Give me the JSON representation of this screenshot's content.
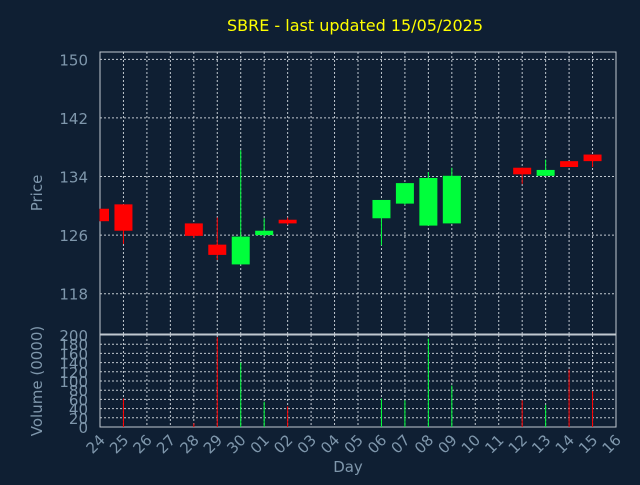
{
  "chart_data": [
    {
      "type": "candlestick",
      "title": "SBRE - last updated 15/05/2025",
      "ylabel": "Price",
      "xlabel": "Day",
      "ylim": [
        112.5,
        151
      ],
      "yticks": [
        118,
        126,
        134,
        142,
        150
      ],
      "grid": true,
      "categories": [
        "24",
        "25",
        "26",
        "27",
        "28",
        "29",
        "30",
        "01",
        "02",
        "03",
        "04",
        "05",
        "06",
        "07",
        "08",
        "09",
        "10",
        "11",
        "12",
        "13",
        "14",
        "15",
        "16"
      ],
      "candles": [
        {
          "day": "24",
          "open": 129.6,
          "high": 129.6,
          "low": 127.9,
          "close": 127.9
        },
        {
          "day": "25",
          "open": 130.2,
          "high": 130.2,
          "low": 124.8,
          "close": 126.6
        },
        {
          "day": "28",
          "open": 127.6,
          "high": 127.6,
          "low": 125.6,
          "close": 125.9
        },
        {
          "day": "29",
          "open": 124.7,
          "high": 128.4,
          "low": 122.6,
          "close": 123.3
        },
        {
          "day": "30",
          "open": 122.0,
          "high": 137.6,
          "low": 122.0,
          "close": 125.8
        },
        {
          "day": "01",
          "open": 126.0,
          "high": 128.3,
          "low": 125.8,
          "close": 126.6
        },
        {
          "day": "02",
          "open": 128.1,
          "high": 128.4,
          "low": 127.4,
          "close": 127.6
        },
        {
          "day": "06",
          "open": 128.3,
          "high": 130.8,
          "low": 124.6,
          "close": 130.8
        },
        {
          "day": "07",
          "open": 130.3,
          "high": 133.1,
          "low": 130.1,
          "close": 133.1
        },
        {
          "day": "08",
          "open": 127.3,
          "high": 134.6,
          "low": 127.3,
          "close": 133.8
        },
        {
          "day": "09",
          "open": 127.6,
          "high": 135.2,
          "low": 127.6,
          "close": 134.1
        },
        {
          "day": "12",
          "open": 135.2,
          "high": 135.2,
          "low": 133.0,
          "close": 134.3
        },
        {
          "day": "13",
          "open": 134.1,
          "high": 136.3,
          "low": 134.1,
          "close": 134.9
        },
        {
          "day": "14",
          "open": 136.1,
          "high": 136.1,
          "low": 135.3,
          "close": 135.3
        },
        {
          "day": "15",
          "open": 137.0,
          "high": 137.0,
          "low": 135.3,
          "close": 136.1
        }
      ]
    },
    {
      "type": "bar",
      "ylabel": "Volume (0000)",
      "ylim": [
        0,
        200
      ],
      "yticks": [
        0,
        20,
        40,
        60,
        80,
        100,
        120,
        140,
        160,
        180,
        200
      ],
      "bars": [
        {
          "day": "25",
          "value": 62,
          "direction": "down"
        },
        {
          "day": "28",
          "value": 8,
          "direction": "down"
        },
        {
          "day": "29",
          "value": 195,
          "direction": "down"
        },
        {
          "day": "30",
          "value": 140,
          "direction": "up"
        },
        {
          "day": "01",
          "value": 55,
          "direction": "up"
        },
        {
          "day": "02",
          "value": 45,
          "direction": "down"
        },
        {
          "day": "06",
          "value": 62,
          "direction": "up"
        },
        {
          "day": "07",
          "value": 58,
          "direction": "up"
        },
        {
          "day": "08",
          "value": 192,
          "direction": "up"
        },
        {
          "day": "09",
          "value": 90,
          "direction": "up"
        },
        {
          "day": "12",
          "value": 58,
          "direction": "down"
        },
        {
          "day": "13",
          "value": 48,
          "direction": "up"
        },
        {
          "day": "14",
          "value": 125,
          "direction": "down"
        },
        {
          "day": "15",
          "value": 78,
          "direction": "down"
        }
      ]
    }
  ],
  "colors": {
    "background": "#0f1f33",
    "title": "#ffff00",
    "axis_text": "#7f97ac",
    "grid": "#c0c8d0",
    "up": "#00ff3b",
    "down": "#ff0000"
  }
}
